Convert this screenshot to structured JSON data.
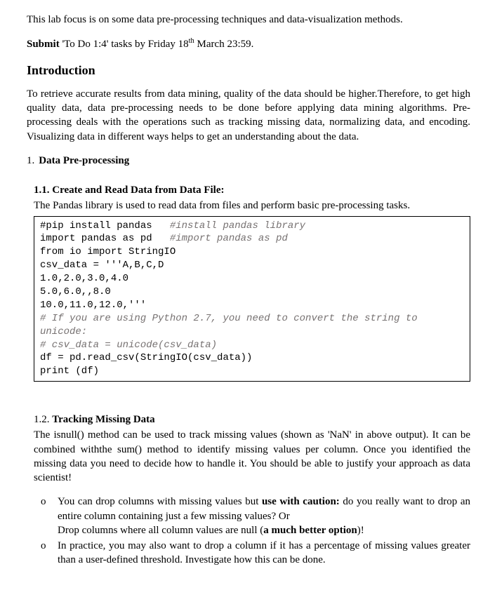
{
  "intro_line": "This lab focus is on some data pre-processing techniques and data-visualization methods.",
  "submit_prefix": "Submit",
  "submit_text_1": " 'To Do 1:4' tasks by Friday 18",
  "submit_sup": "th",
  "submit_text_2": " March 23:59.",
  "heading_intro": "Introduction",
  "intro_para": "To retrieve accurate results from data mining, quality of the data should be higher.Therefore, to get high quality data, data pre-processing needs to be done before applying data mining algorithms. Pre-processing deals with the operations such as tracking missing data, normalizing data, and encoding. Visualizing data in different ways helps to get an understanding about the data.",
  "section1_num": "1.",
  "section1_title": "Data Pre-processing",
  "sub11_title": "1.1. Create and Read Data from Data File:",
  "sub11_para": "The Pandas library is used to read data from files and perform basic pre-processing tasks.",
  "code": {
    "l1a": "#pip install pandas   ",
    "l1b": "#install pandas library",
    "l2a": "import pandas as pd   ",
    "l2b": "#import pandas as pd",
    "l3": "from io import StringIO",
    "l4": "csv_data = '''A,B,C,D",
    "l5": "1.0,2.0,3.0,4.0",
    "l6": "5.0,6.0,,8.0",
    "l7": "10.0,11.0,12.0,'''",
    "l8": "# If you are using Python 2.7, you need to convert the string to unicode:",
    "l9": "# csv_data = unicode(csv_data)",
    "l10": "df = pd.read_csv(StringIO(csv_data))",
    "l11": "print (df)"
  },
  "sub12_num": "1.2. ",
  "sub12_name": "Tracking Missing Data",
  "sub12_para": "The isnull() method can be used to track missing values (shown as 'NaN' in above output). It can be combined withthe sum() method to identify missing values per column. Once you identified the missing data you need to decide how to handle it. You should be able to justify your approach as data scientist!",
  "bullet1_a": "You can drop columns with missing values but ",
  "bullet1_b": "use with caution:",
  "bullet1_c": " do you really want to drop an entire column containing just a few missing values? Or",
  "bullet1_d": "Drop columns where all column values are null (",
  "bullet1_e": "a much better option",
  "bullet1_f": ")!",
  "bullet2": "In practice, you may also want to drop a column if it has a percentage of missing values greater than a user-defined threshold. Investigate how this can be done."
}
